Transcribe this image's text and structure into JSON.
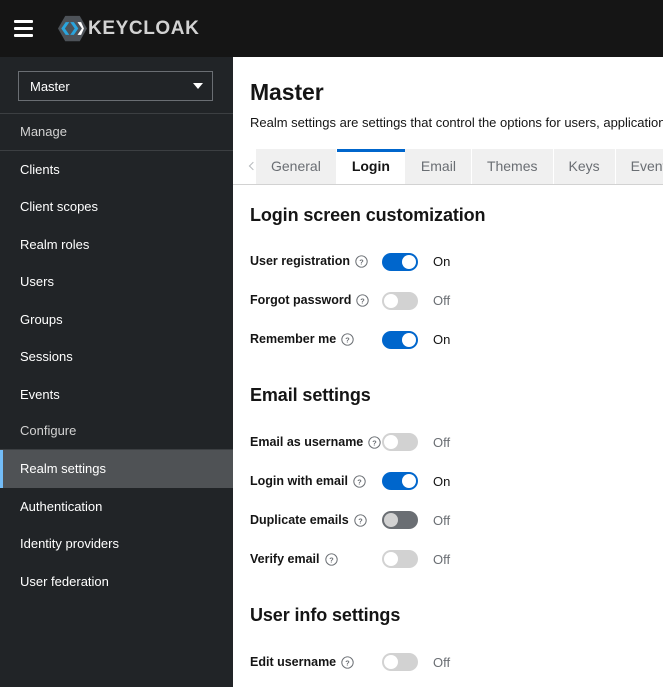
{
  "masthead": {
    "nav_toggle_name": "Global navigation",
    "brand_text": "KEYCLOAK"
  },
  "sidebar": {
    "realm_selector": {
      "value": "Master"
    },
    "sections": [
      {
        "title": "Manage",
        "items": [
          {
            "label": "Clients",
            "active": false
          },
          {
            "label": "Client scopes",
            "active": false
          },
          {
            "label": "Realm roles",
            "active": false
          },
          {
            "label": "Users",
            "active": false
          },
          {
            "label": "Groups",
            "active": false
          },
          {
            "label": "Sessions",
            "active": false
          },
          {
            "label": "Events",
            "active": false
          }
        ]
      },
      {
        "title": "Configure",
        "items": [
          {
            "label": "Realm settings",
            "active": true
          },
          {
            "label": "Authentication",
            "active": false
          },
          {
            "label": "Identity providers",
            "active": false
          },
          {
            "label": "User federation",
            "active": false
          }
        ]
      }
    ]
  },
  "main": {
    "title": "Master",
    "subtitle": "Realm settings are settings that control the options for users, application",
    "tabs": [
      {
        "label": "General",
        "active": false
      },
      {
        "label": "Login",
        "active": true
      },
      {
        "label": "Email",
        "active": false
      },
      {
        "label": "Themes",
        "active": false
      },
      {
        "label": "Keys",
        "active": false
      },
      {
        "label": "Events",
        "active": false
      }
    ],
    "sections": [
      {
        "heading": "Login screen customization",
        "fields": [
          {
            "label": "User registration",
            "state": "On",
            "on": true,
            "dark": false
          },
          {
            "label": "Forgot password",
            "state": "Off",
            "on": false,
            "dark": false
          },
          {
            "label": "Remember me",
            "state": "On",
            "on": true,
            "dark": false
          }
        ]
      },
      {
        "heading": "Email settings",
        "fields": [
          {
            "label": "Email as username",
            "state": "Off",
            "on": false,
            "dark": false
          },
          {
            "label": "Login with email",
            "state": "On",
            "on": true,
            "dark": false
          },
          {
            "label": "Duplicate emails",
            "state": "Off",
            "on": false,
            "dark": true
          },
          {
            "label": "Verify email",
            "state": "Off",
            "on": false,
            "dark": false
          }
        ]
      },
      {
        "heading": "User info settings",
        "fields": [
          {
            "label": "Edit username",
            "state": "Off",
            "on": false,
            "dark": false
          }
        ]
      }
    ]
  },
  "colors": {
    "masthead_bg": "#151515",
    "sidebar_bg": "#212427",
    "active_nav_bg": "#4f5255",
    "active_nav_accent": "#73bcf7",
    "toggle_on": "#06c",
    "toggle_off": "#d2d2d2",
    "toggle_disabled": "#6a6e73",
    "tab_active_accent": "#06c",
    "brand_text": "#d2d2d2"
  },
  "icons": {
    "hamburger": "hamburger-icon",
    "brand_logo": "keycloak-logo-icon",
    "caret": "chevron-down-icon",
    "tab_scroll_left": "chevron-left-icon",
    "help": "help-circle-icon"
  }
}
